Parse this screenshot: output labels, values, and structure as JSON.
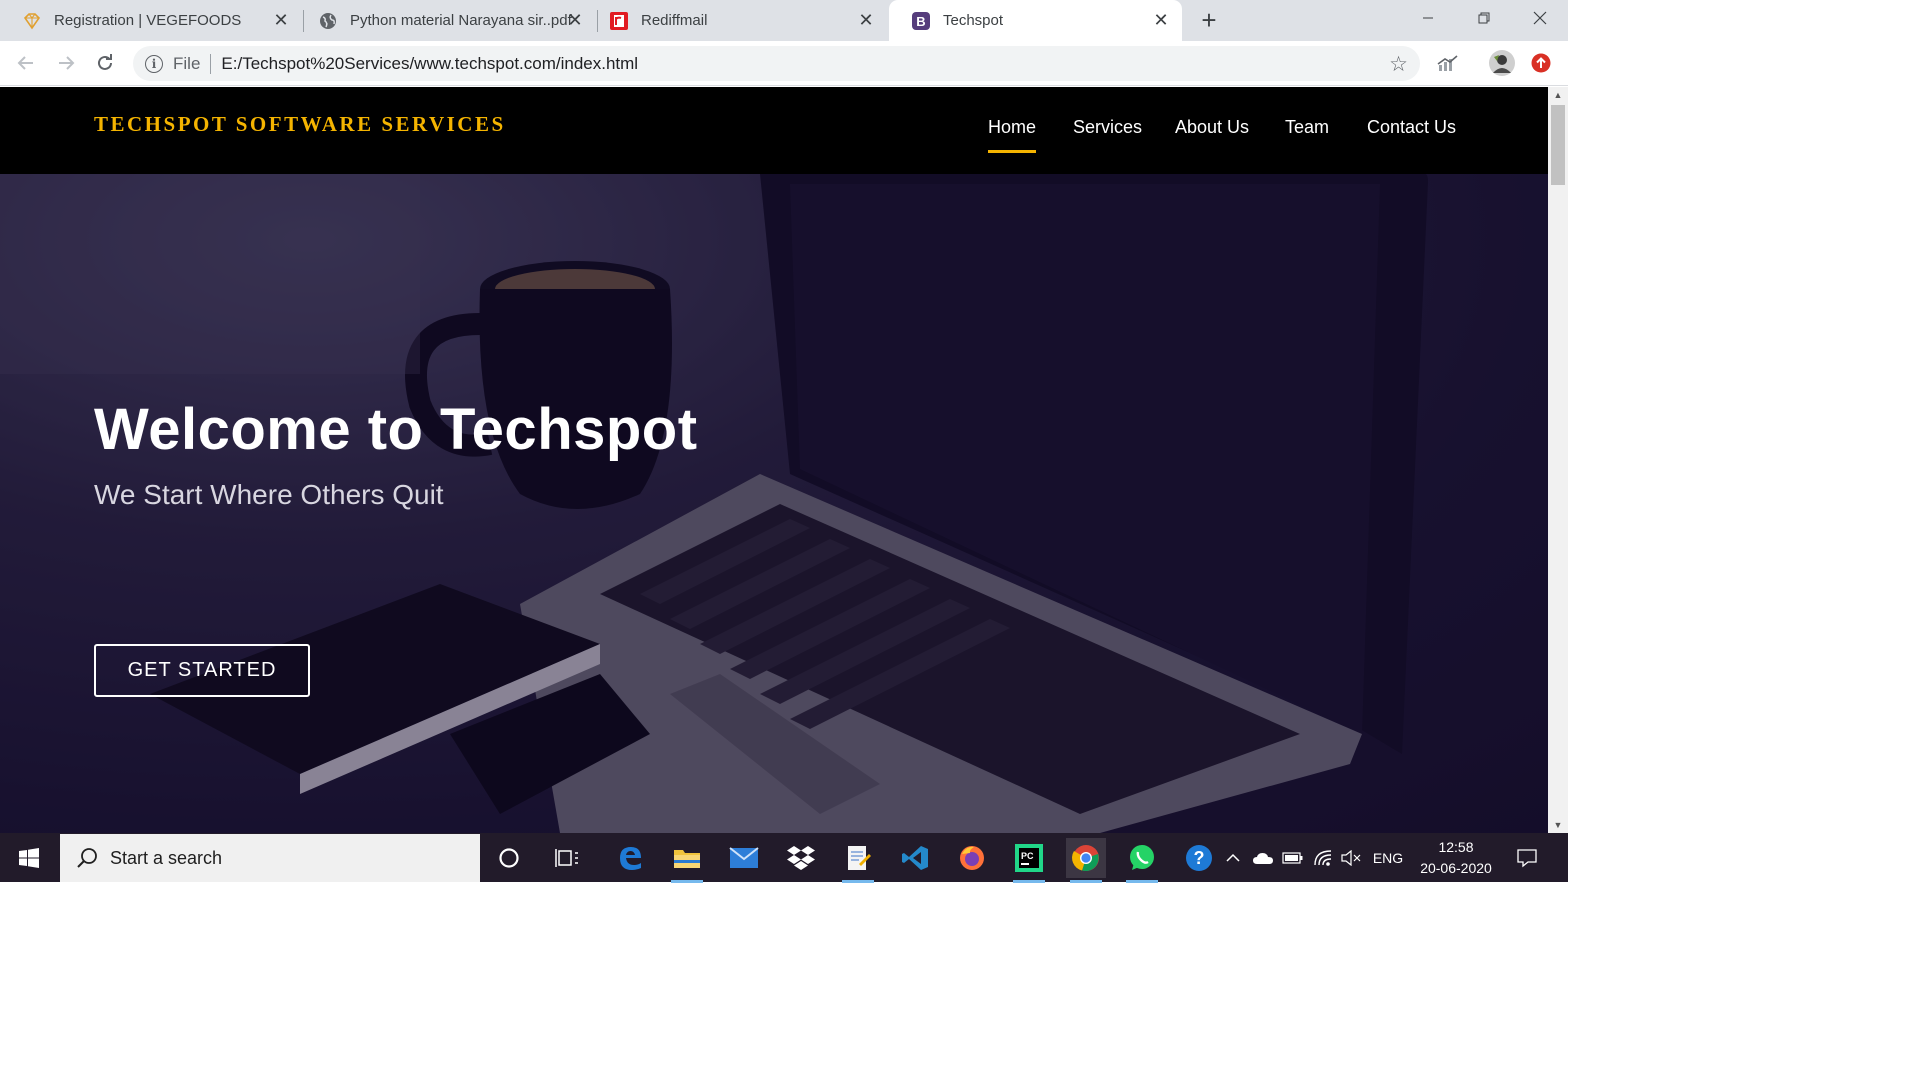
{
  "browser": {
    "tabs": [
      {
        "title": "Registration | VEGEFOODS",
        "favicon": "diamond-icon",
        "active": false
      },
      {
        "title": "Python material Narayana sir..pdf",
        "favicon": "globe-icon",
        "active": false
      },
      {
        "title": "Rediffmail",
        "favicon": "rediff-icon",
        "active": false
      },
      {
        "title": "Techspot",
        "favicon": "bootstrap-icon",
        "active": true
      }
    ],
    "address": {
      "scheme_label": "File",
      "url": "E:/Techspot%20Services/www.techspot.com/index.html"
    }
  },
  "site": {
    "brand": "TECHSPOT SOFTWARE SERVICES",
    "nav": [
      {
        "label": "Home",
        "active": true
      },
      {
        "label": "Services",
        "active": false
      },
      {
        "label": "About Us",
        "active": false
      },
      {
        "label": "Team",
        "active": false
      },
      {
        "label": "Contact Us",
        "active": false
      }
    ],
    "hero": {
      "title": "Welcome to Techspot",
      "subtitle": "We Start Where Others Quit",
      "cta_label": "GET STARTED"
    },
    "colors": {
      "accent": "#f5b400",
      "nav_bg": "#000000",
      "hero_tint": "#1b1530"
    }
  },
  "taskbar": {
    "search_placeholder": "Start a search",
    "language": "ENG",
    "time": "12:58",
    "date": "20-06-2020",
    "pinned": [
      "cortana-icon",
      "task-view-icon",
      "edge-icon",
      "file-explorer-icon",
      "mail-icon",
      "dropbox-icon",
      "notepad-icon",
      "vscode-icon",
      "firefox-icon",
      "pycharm-icon",
      "chrome-icon",
      "whatsapp-icon",
      "help-icon"
    ]
  }
}
